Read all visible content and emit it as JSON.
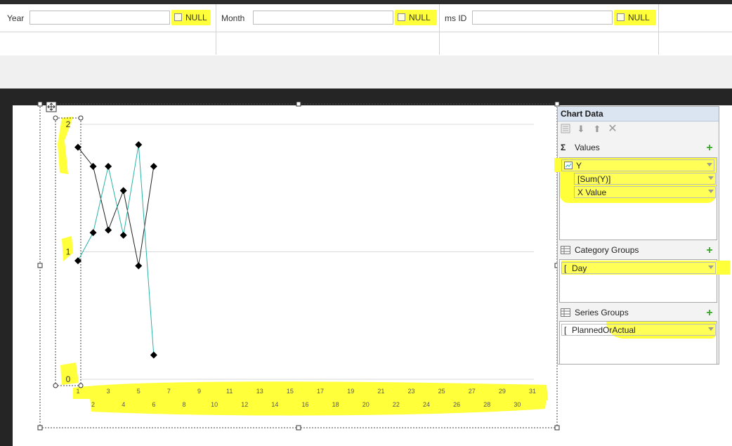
{
  "parameters": [
    {
      "label": "Year",
      "value": "",
      "null_label": "NULL"
    },
    {
      "label": "Month",
      "value": "",
      "null_label": "NULL"
    },
    {
      "label": "ms ID",
      "value": "",
      "null_label": "NULL"
    }
  ],
  "chart_data": {
    "type": "line",
    "x": [
      1,
      2,
      3,
      4,
      5,
      6
    ],
    "series": [
      {
        "values": [
          1.82,
          1.67,
          1.17,
          1.48,
          0.89,
          1.67
        ],
        "color": "#222222"
      },
      {
        "values": [
          0.93,
          1.15,
          1.67,
          1.13,
          1.84,
          0.19
        ],
        "color": "#27b3a8"
      }
    ],
    "ylim": [
      0,
      2
    ],
    "yticks": [
      "0",
      "1",
      "2"
    ],
    "xticks_top": [
      "1",
      "3",
      "5",
      "7",
      "9",
      "11",
      "13",
      "15",
      "17",
      "19",
      "21",
      "23",
      "25",
      "27",
      "29",
      "31"
    ],
    "xticks_bottom": [
      "2",
      "4",
      "6",
      "8",
      "10",
      "12",
      "14",
      "16",
      "18",
      "20",
      "22",
      "24",
      "26",
      "28",
      "30"
    ],
    "xlim": [
      1,
      31
    ],
    "grid": true
  },
  "chart_data_panel": {
    "title": "Chart Data",
    "values_label": "Values",
    "values_fields": [
      "Y",
      "[Sum(Y)]",
      "X Value"
    ],
    "category_label": "Category Groups",
    "category_fields": [
      "Day"
    ],
    "series_label": "Series Groups",
    "series_fields": [
      "PlannedOrActual"
    ]
  },
  "colors": {
    "highlight": "#ffff3a",
    "accent_add": "#3aa629"
  }
}
